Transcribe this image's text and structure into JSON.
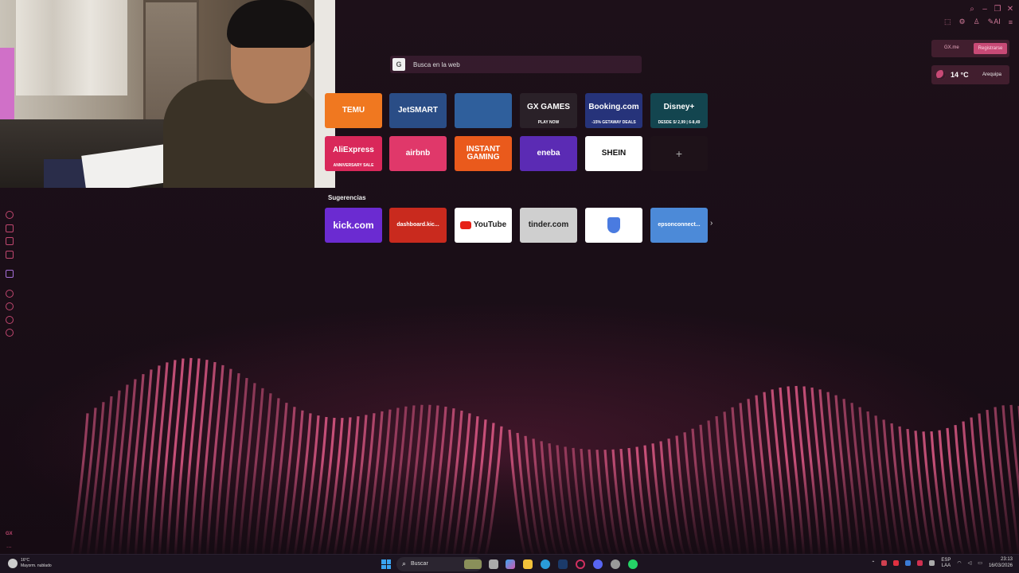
{
  "search": {
    "placeholder": "Busca en la web",
    "engine_icon": "G"
  },
  "speed_dial": [
    {
      "label": "TEMU",
      "bg": "#f07820",
      "name": "temu"
    },
    {
      "label": "JetSMART",
      "bg": "#2a4d86",
      "name": "jetsmart"
    },
    {
      "label": "",
      "bg": "#2f5f9c",
      "name": "world-of-warships"
    },
    {
      "label": "GX GAMES",
      "sub": "PLAY NOW",
      "bg": "#2a2128",
      "name": "gx-games"
    },
    {
      "label": "Booking.com",
      "sub": "-15% GETAWAY DEALS",
      "bg": "#26337a",
      "name": "booking"
    },
    {
      "label": "Disney+",
      "sub": "DESDE S/ 2,99 | 6-8,49",
      "bg": "#13454f",
      "name": "disney-plus"
    },
    {
      "label": "AliExpress",
      "sub": "ANNIVERSARY SALE",
      "bg": "#d9285a",
      "name": "aliexpress"
    },
    {
      "label": "airbnb",
      "bg": "#e0386a",
      "name": "airbnb"
    },
    {
      "label": "INSTANT GAMING",
      "bg": "#ea5a1c",
      "name": "instant-gaming"
    },
    {
      "label": "eneba",
      "bg": "#5b2bb4",
      "name": "eneba"
    },
    {
      "label": "SHEIN",
      "bg": "#ffffff",
      "name": "shein"
    },
    {
      "label": "+",
      "bg": "#1e1219",
      "name": "add-site"
    }
  ],
  "suggestions": {
    "title": "Sugerencias",
    "items": [
      {
        "label": "kick.com",
        "bg": "#6b2bd1",
        "name": "kick"
      },
      {
        "label": "dashboard.kic...",
        "bg": "#c92a1e",
        "name": "dashboard-kick"
      },
      {
        "label": "YouTube",
        "bg": "#ffffff",
        "name": "youtube"
      },
      {
        "label": "tinder.com",
        "bg": "#cfcfcf",
        "name": "tinder"
      },
      {
        "label": "",
        "bg": "#ffffff",
        "name": "google-account"
      },
      {
        "label": "epsonconnect...",
        "bg": "#4c8ad8",
        "name": "epsonconnect"
      }
    ],
    "next": "›"
  },
  "widgets": {
    "gx_label": "GX.me",
    "register": "Registrarse",
    "temperature": "14 °C",
    "city": "Arequipa"
  },
  "toolbar": {
    "ai_label": "AI"
  },
  "sidebar": {
    "gx_label": "GX",
    "more": "..."
  },
  "taskbar": {
    "weather_temp": "16°C",
    "weather_desc": "Mayorm. nublado",
    "search": "Buscar",
    "lang": "ESP",
    "lang_sub": "LAA",
    "time": "23:13",
    "date": "16/03/2026"
  },
  "colors": {
    "accent": "#c0476f",
    "background": "#1a0e17"
  }
}
